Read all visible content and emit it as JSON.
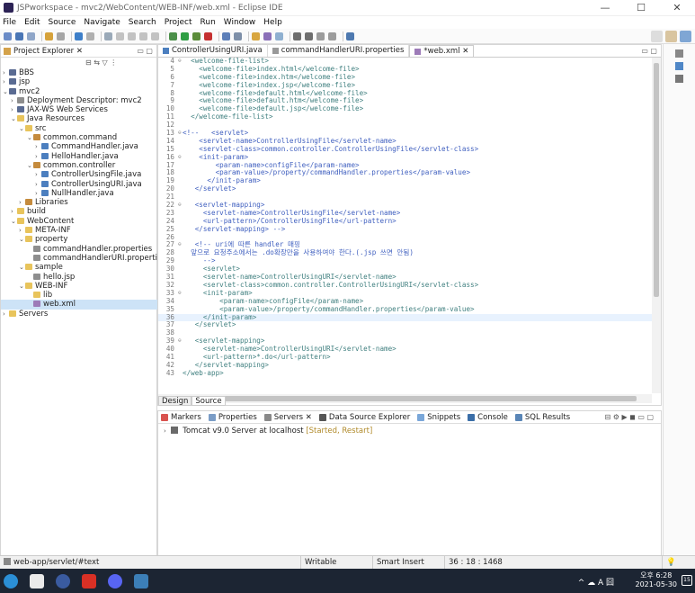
{
  "window": {
    "title": "JSPworkspace - mvc2/WebContent/WEB-INF/web.xml - Eclipse IDE",
    "minimize": "—",
    "maximize": "☐",
    "close": "✕"
  },
  "menu": [
    "File",
    "Edit",
    "Source",
    "Navigate",
    "Search",
    "Project",
    "Run",
    "Window",
    "Help"
  ],
  "explorer": {
    "tab_label": "Project Explorer ✕",
    "items": [
      {
        "label": "BBS",
        "indent": 0,
        "chev": "›",
        "icon": "proj"
      },
      {
        "label": "jsp",
        "indent": 0,
        "chev": "›",
        "icon": "proj"
      },
      {
        "label": "mvc2",
        "indent": 0,
        "chev": "⌄",
        "icon": "proj"
      },
      {
        "label": "Deployment Descriptor: mvc2",
        "indent": 1,
        "chev": "›",
        "icon": "prop"
      },
      {
        "label": "JAX-WS Web Services",
        "indent": 1,
        "chev": "›",
        "icon": "proj"
      },
      {
        "label": "Java Resources",
        "indent": 1,
        "chev": "⌄",
        "icon": "fold"
      },
      {
        "label": "src",
        "indent": 2,
        "chev": "⌄",
        "icon": "fold"
      },
      {
        "label": "common.command",
        "indent": 3,
        "chev": "⌄",
        "icon": "pkg"
      },
      {
        "label": "CommandHandler.java",
        "indent": 4,
        "chev": "›",
        "icon": "jfile"
      },
      {
        "label": "HelloHandler.java",
        "indent": 4,
        "chev": "›",
        "icon": "jfile"
      },
      {
        "label": "common.controller",
        "indent": 3,
        "chev": "⌄",
        "icon": "pkg"
      },
      {
        "label": "ControllerUsingFile.java",
        "indent": 4,
        "chev": "›",
        "icon": "jfile"
      },
      {
        "label": "ControllerUsingURI.java",
        "indent": 4,
        "chev": "›",
        "icon": "jfile"
      },
      {
        "label": "NullHandler.java",
        "indent": 4,
        "chev": "›",
        "icon": "jfile"
      },
      {
        "label": "Libraries",
        "indent": 2,
        "chev": "›",
        "icon": "pkg"
      },
      {
        "label": "build",
        "indent": 1,
        "chev": "›",
        "icon": "fold"
      },
      {
        "label": "WebContent",
        "indent": 1,
        "chev": "⌄",
        "icon": "fold"
      },
      {
        "label": "META-INF",
        "indent": 2,
        "chev": "›",
        "icon": "fold"
      },
      {
        "label": "property",
        "indent": 2,
        "chev": "⌄",
        "icon": "fold"
      },
      {
        "label": "commandHandler.properties",
        "indent": 3,
        "chev": "",
        "icon": "prop"
      },
      {
        "label": "commandHandlerURI.properties",
        "indent": 3,
        "chev": "",
        "icon": "prop"
      },
      {
        "label": "sample",
        "indent": 2,
        "chev": "⌄",
        "icon": "fold"
      },
      {
        "label": "hello.jsp",
        "indent": 3,
        "chev": "",
        "icon": "prop"
      },
      {
        "label": "WEB-INF",
        "indent": 2,
        "chev": "⌄",
        "icon": "fold"
      },
      {
        "label": "lib",
        "indent": 3,
        "chev": "",
        "icon": "fold"
      },
      {
        "label": "web.xml",
        "indent": 3,
        "chev": "",
        "icon": "xml",
        "selected": true
      },
      {
        "label": "Servers",
        "indent": 0,
        "chev": "›",
        "icon": "fold"
      }
    ]
  },
  "editor": {
    "tabs": [
      {
        "label": "ControllerUsingURI.java",
        "active": false
      },
      {
        "label": "commandHandlerURI.properties",
        "active": false
      },
      {
        "label": "*web.xml ✕",
        "active": true
      }
    ],
    "lines": [
      {
        "n": "4",
        "f": "⊖",
        "t": "  <welcome-file-list>"
      },
      {
        "n": "5",
        "f": "",
        "t": "    <welcome-file>index.html</welcome-file>"
      },
      {
        "n": "6",
        "f": "",
        "t": "    <welcome-file>index.htm</welcome-file>"
      },
      {
        "n": "7",
        "f": "",
        "t": "    <welcome-file>index.jsp</welcome-file>"
      },
      {
        "n": "8",
        "f": "",
        "t": "    <welcome-file>default.html</welcome-file>"
      },
      {
        "n": "9",
        "f": "",
        "t": "    <welcome-file>default.htm</welcome-file>"
      },
      {
        "n": "10",
        "f": "",
        "t": "    <welcome-file>default.jsp</welcome-file>"
      },
      {
        "n": "11",
        "f": "",
        "t": "  </welcome-file-list>"
      },
      {
        "n": "12",
        "f": "",
        "t": ""
      },
      {
        "n": "13",
        "f": "⊖",
        "t": "<!--   <servlet>"
      },
      {
        "n": "14",
        "f": "",
        "t": "    <servlet-name>ControllerUsingFile</servlet-name>"
      },
      {
        "n": "15",
        "f": "",
        "t": "    <servlet-class>common.controller.ControllerUsingFile</servlet-class>"
      },
      {
        "n": "16",
        "f": "⊖",
        "t": "    <init-param>"
      },
      {
        "n": "17",
        "f": "",
        "t": "        <param-name>configFile</param-name>"
      },
      {
        "n": "18",
        "f": "",
        "t": "        <param-value>/property/commandHandler.properties</param-value>"
      },
      {
        "n": "19",
        "f": "",
        "t": "      </init-param>"
      },
      {
        "n": "20",
        "f": "",
        "t": "   </servlet>"
      },
      {
        "n": "21",
        "f": "",
        "t": ""
      },
      {
        "n": "22",
        "f": "⊖",
        "t": "   <servlet-mapping>"
      },
      {
        "n": "23",
        "f": "",
        "t": "     <servlet-name>ControllerUsingFile</servlet-name>"
      },
      {
        "n": "24",
        "f": "",
        "t": "     <url-pattern>/ControllerUsingFile</url-pattern>"
      },
      {
        "n": "25",
        "f": "",
        "t": "   </servlet-mapping> -->"
      },
      {
        "n": "26",
        "f": "",
        "t": ""
      },
      {
        "n": "27",
        "f": "⊖",
        "t": "   <!-- uri에 따른 handler 매핑"
      },
      {
        "n": "28",
        "f": "",
        "t": "  앞으로 요청주소에서는 .do확장만을 사용하여야 한다.(.jsp 쓰면 안됨)"
      },
      {
        "n": "29",
        "f": "",
        "t": "     -->"
      },
      {
        "n": "30",
        "f": "",
        "t": "     <servlet>"
      },
      {
        "n": "31",
        "f": "",
        "t": "     <servlet-name>ControllerUsingURI</servlet-name>"
      },
      {
        "n": "32",
        "f": "",
        "t": "     <servlet-class>common.controller.ControllerUsingURI</servlet-class>"
      },
      {
        "n": "33",
        "f": "⊖",
        "t": "     <init-param>"
      },
      {
        "n": "34",
        "f": "",
        "t": "         <param-name>configFile</param-name>"
      },
      {
        "n": "35",
        "f": "",
        "t": "         <param-value>/property/commandHandler.properties</param-value>"
      },
      {
        "n": "36",
        "f": "",
        "t": "     </init-param>",
        "current": true
      },
      {
        "n": "37",
        "f": "",
        "t": "   </servlet>"
      },
      {
        "n": "38",
        "f": "",
        "t": ""
      },
      {
        "n": "39",
        "f": "⊖",
        "t": "   <servlet-mapping>"
      },
      {
        "n": "40",
        "f": "",
        "t": "     <servlet-name>ControllerUsingURI</servlet-name>"
      },
      {
        "n": "41",
        "f": "",
        "t": "     <url-pattern>*.do</url-pattern>"
      },
      {
        "n": "42",
        "f": "",
        "t": "   </servlet-mapping>"
      },
      {
        "n": "43",
        "f": "",
        "t": "</web-app>"
      }
    ],
    "design_tab": "Design",
    "source_tab": "Source"
  },
  "bottom": {
    "tabs": [
      "Markers",
      "Properties",
      "Servers ✕",
      "Data Source Explorer",
      "Snippets",
      "Console",
      "SQL Results"
    ],
    "server_name": "Tomcat v9.0 Server at localhost",
    "server_state": "[Started, Restart]"
  },
  "status": {
    "path": "web-app/servlet/#text",
    "writable": "Writable",
    "insert": "Smart Insert",
    "position": "36 : 18 : 1468"
  },
  "taskbar": {
    "time": "오후 6:28",
    "date": "2021-05-30",
    "tray": "^ ☁ A 囧",
    "notification": "15"
  }
}
